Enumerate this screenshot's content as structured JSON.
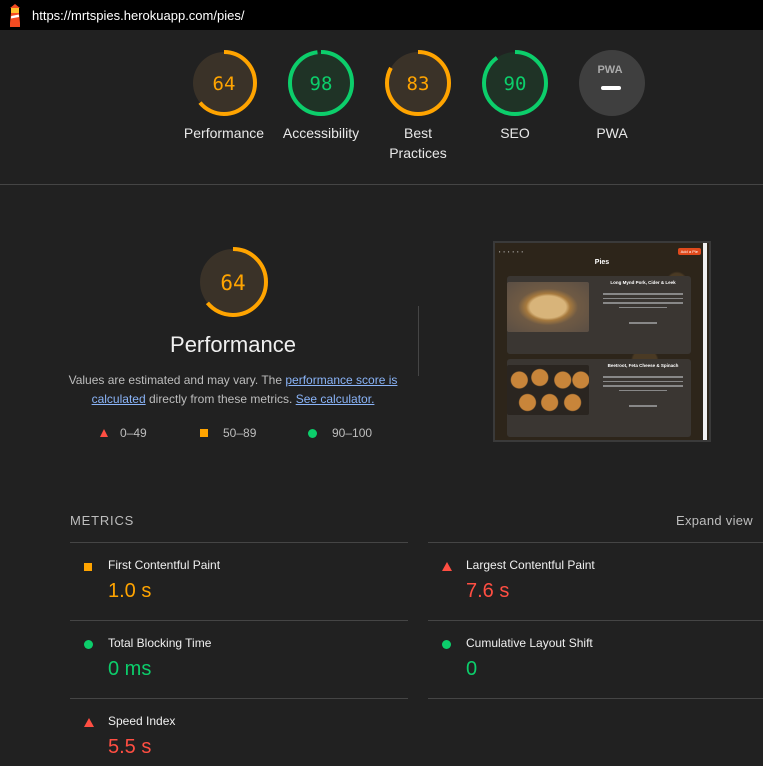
{
  "url": "https://mrtspies.herokuapp.com/pies/",
  "colors": {
    "fail": "#ff4e42",
    "average": "#ffa400",
    "pass": "#0cce6b",
    "link": "#8ab4f8"
  },
  "gauges": [
    {
      "score": "64",
      "value": 64,
      "label": "Performance",
      "status": "average"
    },
    {
      "score": "98",
      "value": 98,
      "label": "Accessibility",
      "status": "pass"
    },
    {
      "score": "83",
      "value": 83,
      "label": "Best Practices",
      "status": "average"
    },
    {
      "score": "90",
      "value": 90,
      "label": "SEO",
      "status": "pass"
    },
    {
      "score": "PWA",
      "label": "PWA",
      "status": "na"
    }
  ],
  "performance": {
    "score": "64",
    "value": 64,
    "title": "Performance",
    "desc_prefix": "Values are estimated and may vary. The ",
    "desc_link1": "performance score is calculated",
    "desc_middle": " directly from these metrics. ",
    "desc_link2": "See calculator."
  },
  "legend": {
    "fail": "0–49",
    "average": "50–89",
    "pass": "90–100"
  },
  "thumbnail": {
    "page_title": "Pies",
    "card1_title": "Long Mynd Pork, Cider & Leek",
    "card2_title": "Beetroot, Feta Cheese & Spinach",
    "nav_button": "Add a Pie"
  },
  "metrics": {
    "heading": "METRICS",
    "expand": "Expand view",
    "items": [
      {
        "name": "First Contentful Paint",
        "value": "1.0 s",
        "status": "average"
      },
      {
        "name": "Largest Contentful Paint",
        "value": "7.6 s",
        "status": "fail"
      },
      {
        "name": "Total Blocking Time",
        "value": "0 ms",
        "status": "pass"
      },
      {
        "name": "Cumulative Layout Shift",
        "value": "0",
        "status": "pass"
      },
      {
        "name": "Speed Index",
        "value": "5.5 s",
        "status": "fail"
      }
    ]
  }
}
